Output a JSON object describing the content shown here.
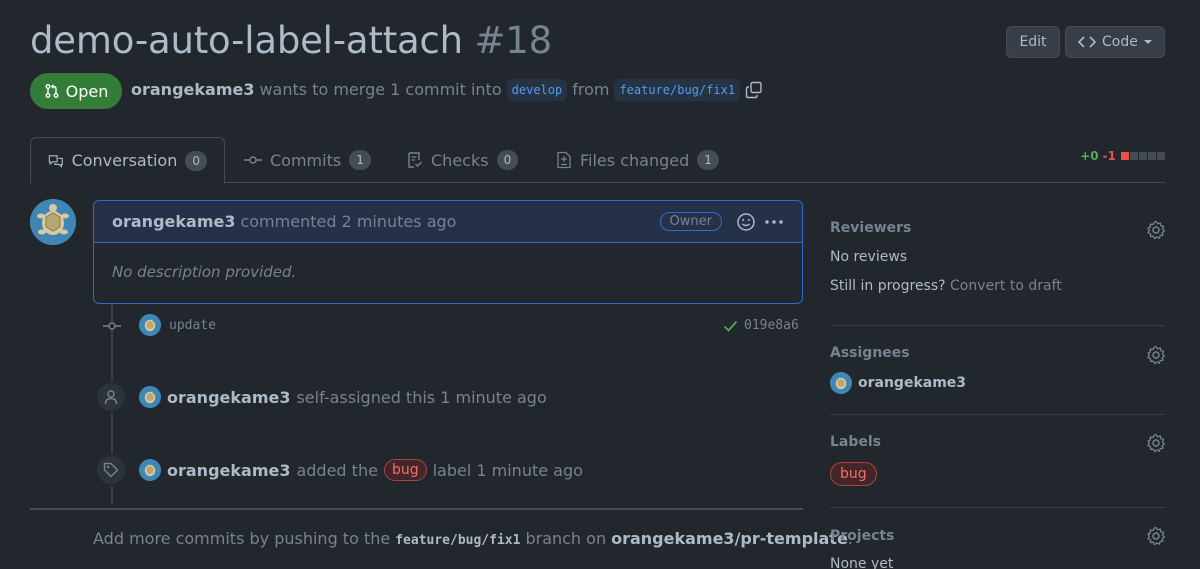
{
  "header": {
    "title": "demo-auto-label-attach",
    "number": "#18",
    "edit_label": "Edit",
    "code_label": "Code"
  },
  "state": {
    "label": "Open",
    "author": "orangekame3",
    "merge_text": "wants to merge 1 commit into",
    "base_branch": "develop",
    "from_text": "from",
    "head_branch": "feature/bug/fix1"
  },
  "tabs": [
    {
      "label": "Conversation",
      "count": "0"
    },
    {
      "label": "Commits",
      "count": "1"
    },
    {
      "label": "Checks",
      "count": "0"
    },
    {
      "label": "Files changed",
      "count": "1"
    }
  ],
  "diffstat": {
    "additions": "+0",
    "deletions": "-1"
  },
  "comment": {
    "author": "orangekame3",
    "action": "commented 2 minutes ago",
    "role": "Owner",
    "body": "No description provided."
  },
  "timeline": {
    "commit_message": "update",
    "commit_sha": "019e8a6",
    "assign_author": "orangekame3",
    "assign_text": "self-assigned this 1 minute ago",
    "label_author": "orangekame3",
    "label_prefix": "added the",
    "label_name": "bug",
    "label_suffix": "label 1 minute ago"
  },
  "footer": {
    "prefix": "Add more commits by pushing to the",
    "branch": "feature/bug/fix1",
    "middle": "branch on",
    "repo": "orangekame3/pr-template",
    "suffix": "."
  },
  "sidebar": {
    "reviewers": {
      "heading": "Reviewers",
      "value": "No reviews",
      "progress_text": "Still in progress?",
      "convert_link": "Convert to draft"
    },
    "assignees": {
      "heading": "Assignees",
      "value": "orangekame3"
    },
    "labels": {
      "heading": "Labels",
      "value": "bug"
    },
    "projects": {
      "heading": "Projects",
      "value": "None yet"
    }
  },
  "colors": {
    "open_green": "#347d39",
    "accent_blue": "#316dca",
    "background": "#22272e"
  }
}
